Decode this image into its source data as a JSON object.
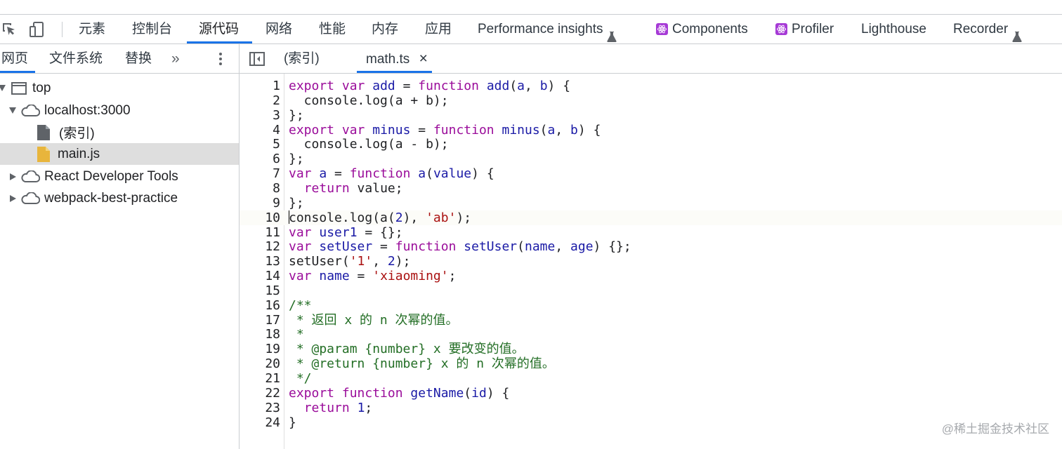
{
  "main_tabs": [
    {
      "label": "元素"
    },
    {
      "label": "控制台"
    },
    {
      "label": "源代码",
      "active": true
    },
    {
      "label": "网络"
    },
    {
      "label": "性能"
    },
    {
      "label": "内存"
    },
    {
      "label": "应用"
    },
    {
      "label": "Performance insights",
      "icon": "flask-icon"
    },
    {
      "label": "Components",
      "icon": "react-icon"
    },
    {
      "label": "Profiler",
      "icon": "react-icon"
    },
    {
      "label": "Lighthouse"
    },
    {
      "label": "Recorder",
      "icon": "flask-icon"
    }
  ],
  "navigator_tabs": [
    {
      "label": "网页",
      "active": true
    },
    {
      "label": "文件系统"
    },
    {
      "label": "替换"
    }
  ],
  "navigator_more": "»",
  "editor_tabs": [
    {
      "label": "(索引)"
    },
    {
      "label": "math.ts",
      "active": true,
      "close": "×"
    }
  ],
  "tree": [
    {
      "label": "top",
      "icon": "frame-icon",
      "expanded": true
    },
    {
      "label": "localhost:3000",
      "icon": "cloud-icon",
      "expanded": true
    },
    {
      "label": "(索引)",
      "icon": "document-icon"
    },
    {
      "label": "main.js",
      "icon": "js-file-icon",
      "selected": true
    },
    {
      "label": "React Developer Tools",
      "icon": "cloud-icon",
      "expanded": false
    },
    {
      "label": "webpack-best-practice",
      "icon": "cloud-icon",
      "expanded": false
    }
  ],
  "code": {
    "current_line": 10,
    "lines": [
      {
        "n": "1",
        "text": "export var add = function add(a, b) {"
      },
      {
        "n": "2",
        "text": "  console.log(a + b);"
      },
      {
        "n": "3",
        "text": "};"
      },
      {
        "n": "4",
        "text": "export var minus = function minus(a, b) {"
      },
      {
        "n": "5",
        "text": "  console.log(a - b);"
      },
      {
        "n": "6",
        "text": "};"
      },
      {
        "n": "7",
        "text": "var a = function a(value) {"
      },
      {
        "n": "8",
        "text": "  return value;"
      },
      {
        "n": "9",
        "text": "};"
      },
      {
        "n": "10",
        "text": "console.log(a(2), 'ab');"
      },
      {
        "n": "11",
        "text": "var user1 = {};"
      },
      {
        "n": "12",
        "text": "var setUser = function setUser(name, age) {};"
      },
      {
        "n": "13",
        "text": "setUser('1', 2);"
      },
      {
        "n": "14",
        "text": "var name = 'xiaoming';"
      },
      {
        "n": "15",
        "text": ""
      },
      {
        "n": "16",
        "text": "/**"
      },
      {
        "n": "17",
        "text": " * 返回 x 的 n 次幂的值。"
      },
      {
        "n": "18",
        "text": " *"
      },
      {
        "n": "19",
        "text": " * @param {number} x 要改变的值。"
      },
      {
        "n": "20",
        "text": " * @return {number} x 的 n 次幂的值。"
      },
      {
        "n": "21",
        "text": " */"
      },
      {
        "n": "22",
        "text": "export function getName(id) {"
      },
      {
        "n": "23",
        "text": "  return 1;"
      },
      {
        "n": "24",
        "text": "}"
      }
    ]
  },
  "watermark": "@稀土掘金技术社区"
}
